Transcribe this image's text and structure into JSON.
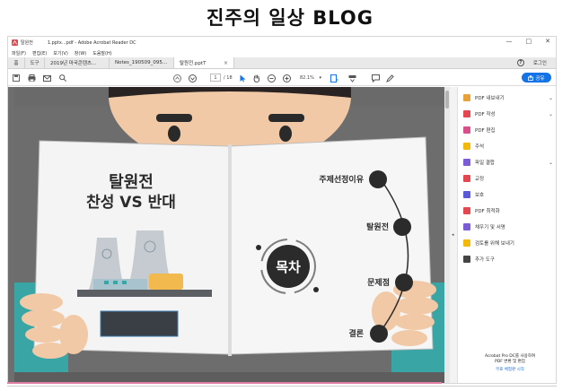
{
  "blog": {
    "title": "진주의 일상 BLOG"
  },
  "window": {
    "doc_name": "탈원전",
    "title": "1.pptx...pdf - Adobe Acrobat Reader DC",
    "controls": [
      "—",
      "□",
      "✕"
    ]
  },
  "menu": [
    "파일(F)",
    "편집(E)",
    "보기(V)",
    "창(W)",
    "도움말(H)"
  ],
  "tabs": {
    "home": "홈",
    "tools": "도구",
    "files": [
      "2019년 마국콘텐츠...",
      "Notes_190509_095...",
      "탈원전.pptT"
    ],
    "close": "×",
    "help": "?",
    "login": "로그인"
  },
  "toolbar": {
    "page_current": "1",
    "page_total": "/ 18",
    "zoom": "82.1%",
    "share_label": "공유"
  },
  "slide": {
    "title_line1": "탈원전",
    "title_line2": "찬성 VS 반대",
    "center_label": "목차",
    "toc": [
      "주제선정이유",
      "탈원전",
      "문제점",
      "결론"
    ]
  },
  "sidebar": {
    "items": [
      {
        "label": "PDF 내보내기",
        "icon": "export-pdf-icon",
        "color": "#e8a23a",
        "chevron": true
      },
      {
        "label": "PDF 작성",
        "icon": "create-pdf-icon",
        "color": "#e34850",
        "chevron": true
      },
      {
        "label": "PDF 편집",
        "icon": "edit-pdf-icon",
        "color": "#d94f8a",
        "chevron": false
      },
      {
        "label": "주석",
        "icon": "comment-icon",
        "color": "#f0b90b",
        "chevron": false
      },
      {
        "label": "파일 결합",
        "icon": "combine-files-icon",
        "color": "#7b5cd6",
        "chevron": true
      },
      {
        "label": "교정",
        "icon": "redact-icon",
        "color": "#e34850",
        "chevron": false
      },
      {
        "label": "보호",
        "icon": "protect-icon",
        "color": "#5a5ad6",
        "chevron": false
      },
      {
        "label": "PDF 최적화",
        "icon": "optimize-pdf-icon",
        "color": "#e34850",
        "chevron": false
      },
      {
        "label": "채우기 및 서명",
        "icon": "fill-sign-icon",
        "color": "#7b5cd6",
        "chevron": false
      },
      {
        "label": "검토를 위해 보내기",
        "icon": "send-review-icon",
        "color": "#f0b90b",
        "chevron": false
      },
      {
        "label": "추가 도구",
        "icon": "more-tools-icon",
        "color": "#444444",
        "chevron": false
      }
    ],
    "footer_line1": "Acrobat Pro DC를 사용하여",
    "footer_line2": "PDF 변환 및 편집",
    "footer_trial": "무료 체험판 시작"
  },
  "colors": {
    "accent": "#1473e6",
    "slide_dark": "#222222",
    "bg_gray": "#6e6e6e"
  }
}
